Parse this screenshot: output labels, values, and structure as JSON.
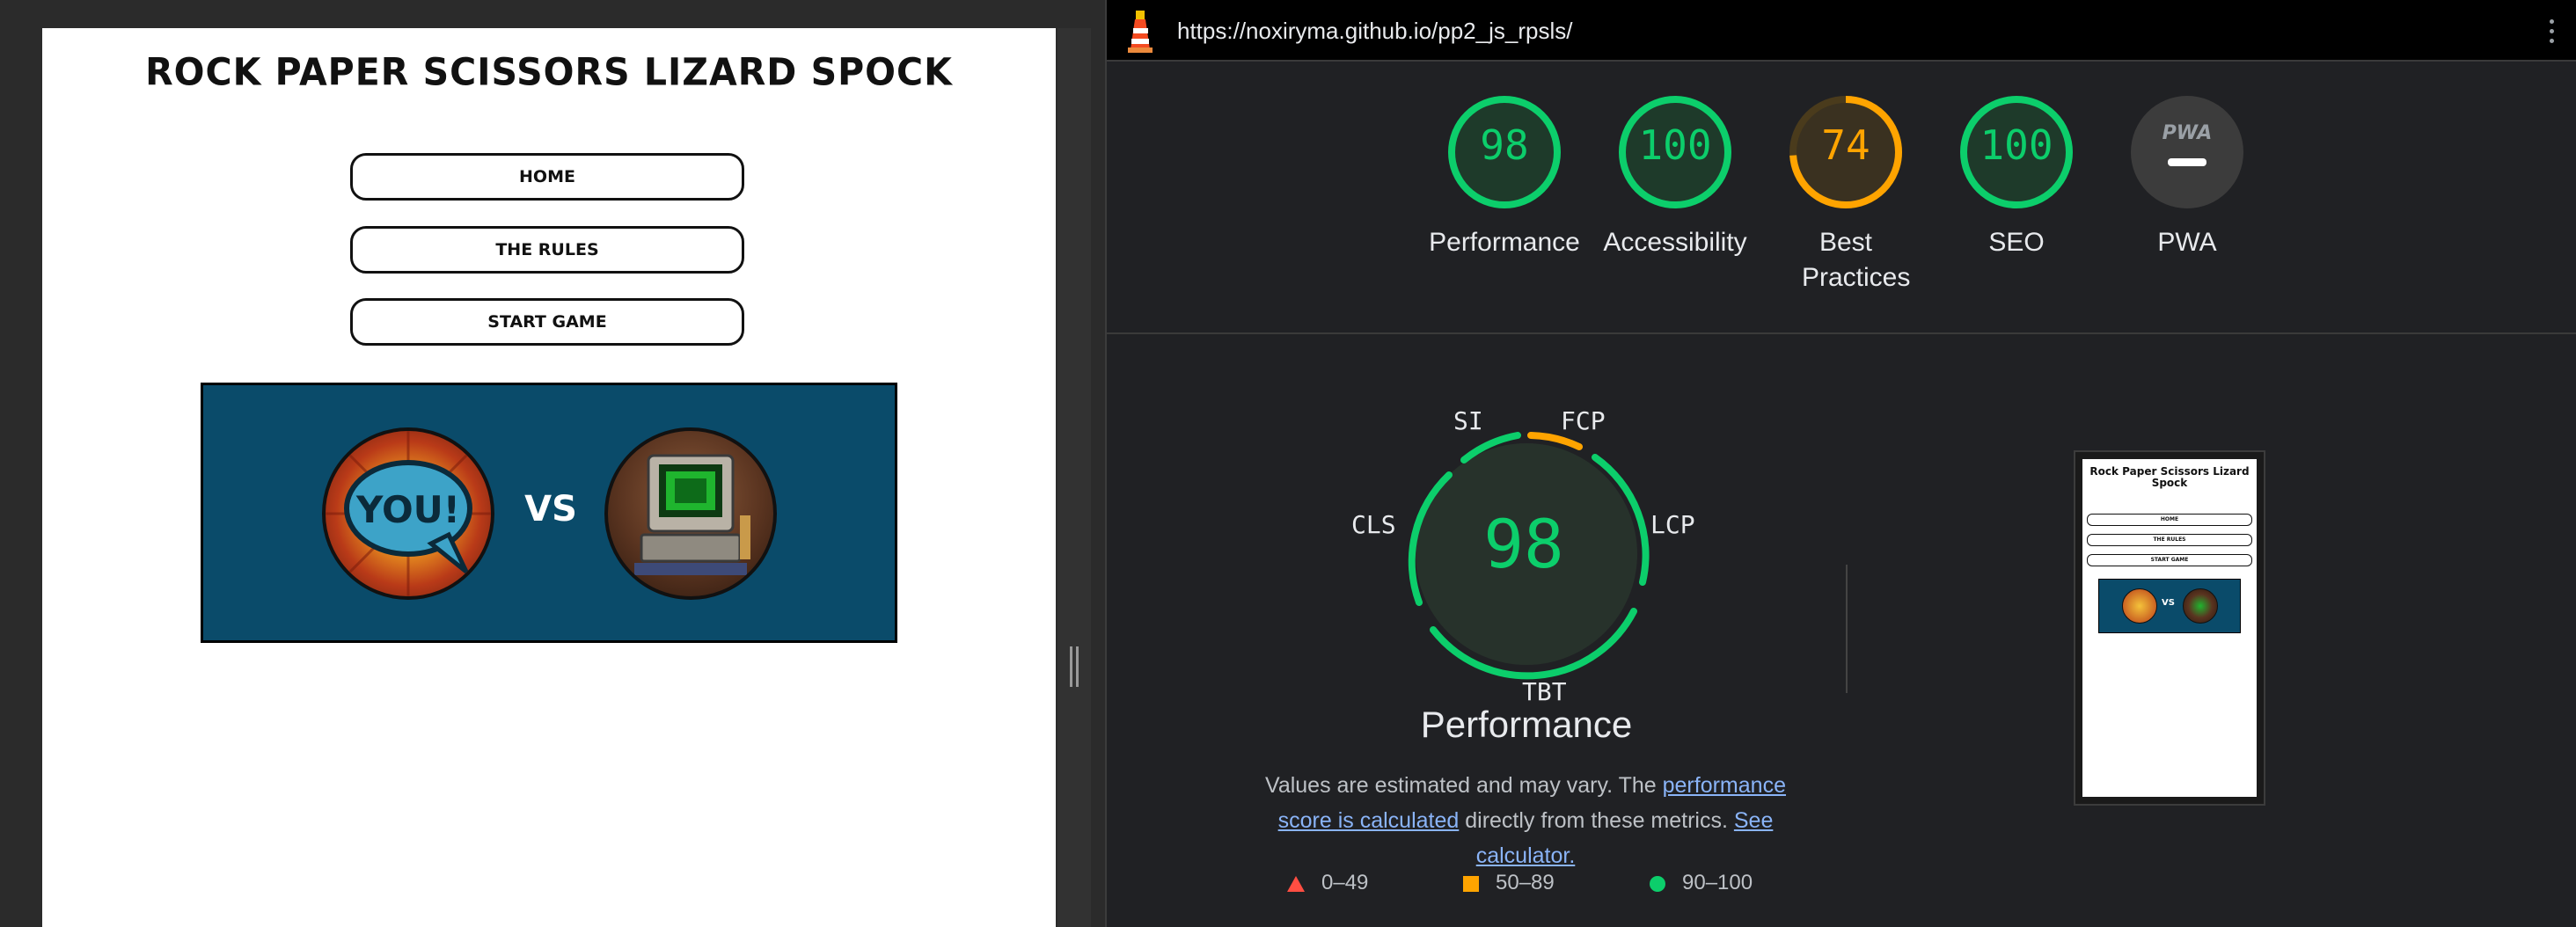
{
  "site": {
    "title": "Rock Paper Scissors Lizard Spock",
    "nav": [
      "HOME",
      "THE RULES",
      "START GAME"
    ],
    "banner": {
      "you_text": "YOU!",
      "vs_text": "VS"
    }
  },
  "lighthouse": {
    "url": "https://noxiryma.github.io/pp2_js_rpsls/",
    "categories": [
      {
        "score": "98",
        "label": "Performance",
        "color": "#0cce6b"
      },
      {
        "score": "100",
        "label": "Accessibility",
        "color": "#0cce6b"
      },
      {
        "score": "74",
        "label": "Best Practices",
        "color": "#ffa400"
      },
      {
        "score": "100",
        "label": "SEO",
        "color": "#0cce6b"
      },
      {
        "score": "",
        "label": "PWA",
        "color": "#9aa0a6",
        "badge": "PWA"
      }
    ],
    "performance": {
      "score": "98",
      "title": "Performance",
      "metrics": [
        "SI",
        "FCP",
        "LCP",
        "TBT",
        "CLS"
      ],
      "note_prefix": "Values are estimated and may vary. The ",
      "note_link1": "performance score is calculated",
      "note_mid": " directly from these metrics. ",
      "note_link2": "See calculator."
    },
    "legend": [
      {
        "range": "0–49",
        "color": "#ff4e42",
        "shape": "triangle"
      },
      {
        "range": "50–89",
        "color": "#ffa400",
        "shape": "square"
      },
      {
        "range": "90–100",
        "color": "#0cce6b",
        "shape": "circle"
      }
    ],
    "thumbnail": {
      "title": "Rock Paper Scissors Lizard Spock",
      "nav": [
        "HOME",
        "THE RULES",
        "START GAME"
      ],
      "vs_text": "VS"
    }
  }
}
